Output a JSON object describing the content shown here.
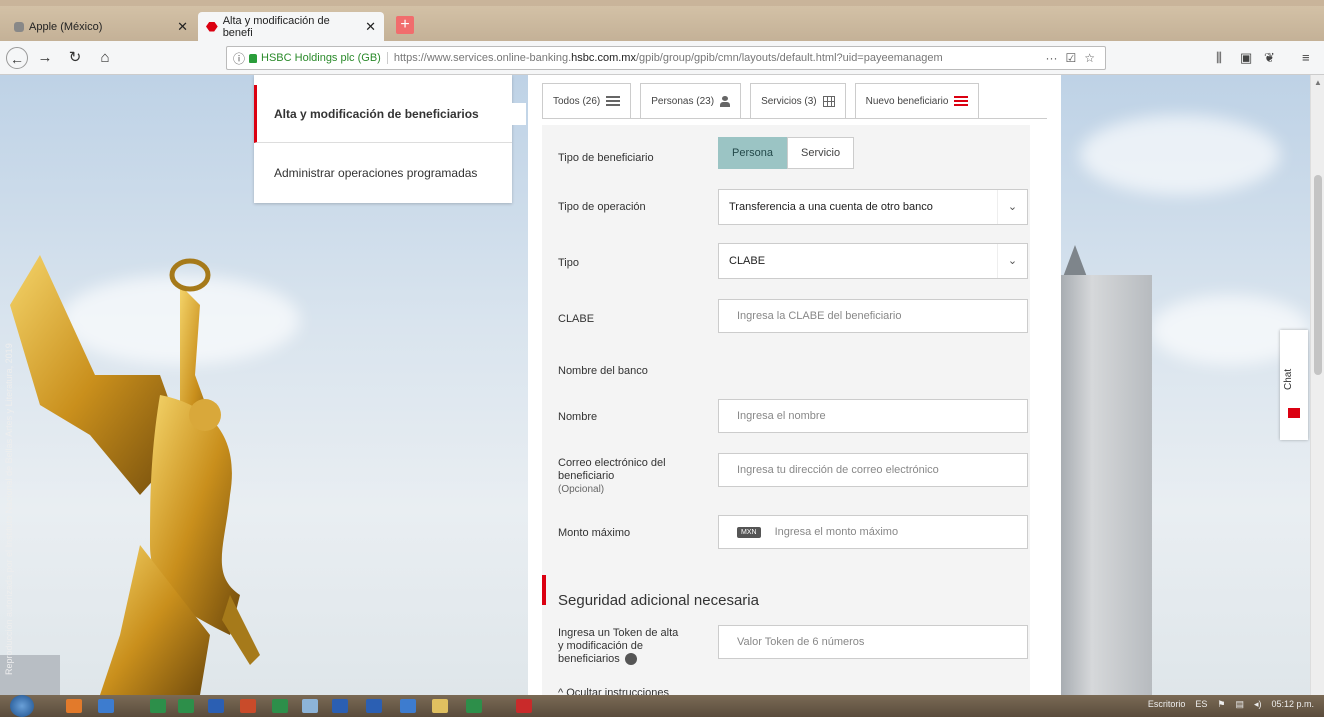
{
  "browser": {
    "tabs": [
      {
        "label": "Apple (México)",
        "active": false
      },
      {
        "label": "Alta y modificación de benefi",
        "active": true
      }
    ],
    "cert_label": "HSBC Holdings plc (GB)",
    "url_prefix": "https://www.services.online-banking.",
    "url_host": "hsbc.com.mx",
    "url_suffix": "/gpib/group/gpib/cmn/layouts/default.html?uid=payeemanagem",
    "url_more": "···"
  },
  "page": {
    "photo_credit": "Reproducción autorizada por el Instituto Nacional de Bellas Artes y Literatura, 2019"
  },
  "sidemenu": {
    "items": [
      {
        "label": "Alta y modificación de beneficiarios",
        "selected": true
      },
      {
        "label": "Administrar operaciones programadas",
        "selected": false
      }
    ]
  },
  "tabs": [
    {
      "label": "Todos (26)",
      "icon": "list-icon"
    },
    {
      "label": "Personas (23)",
      "icon": "person-icon"
    },
    {
      "label": "Servicios (3)",
      "icon": "grid-icon"
    },
    {
      "label": "Nuevo beneficiario",
      "icon": "list-red-icon"
    }
  ],
  "form": {
    "tipo_beneficiario_label": "Tipo de beneficiario",
    "toggle_persona": "Persona",
    "toggle_servicio": "Servicio",
    "tipo_operacion_label": "Tipo de operación",
    "tipo_operacion_value": "Transferencia a una cuenta de otro banco",
    "tipo_label": "Tipo",
    "tipo_value": "CLABE",
    "clabe_label": "CLABE",
    "clabe_placeholder": "Ingresa la CLABE del beneficiario",
    "banco_label": "Nombre del banco",
    "nombre_label": "Nombre",
    "nombre_placeholder": "Ingresa el nombre",
    "correo_label_1": "Correo electrónico del",
    "correo_label_2": "beneficiario",
    "correo_optional": "(Opcional)",
    "correo_placeholder": "Ingresa tu dirección de correo electrónico",
    "monto_label": "Monto máximo",
    "monto_badge": "MXN",
    "monto_placeholder": "Ingresa el monto máximo",
    "seguridad_title": "Seguridad adicional necesaria",
    "token_label_1": "Ingresa un Token de alta",
    "token_label_2": "y modificación de",
    "token_label_3": "beneficiarios",
    "token_placeholder": "Valor Token de 6 números",
    "ocultar": "Ocultar instrucciones"
  },
  "chat": {
    "label": "Chat"
  },
  "taskbar": {
    "lang": "Escritorio",
    "locale": "ES",
    "time": "05:12 p.m."
  },
  "colors": {
    "brand_red": "#db0011",
    "toggle_active": "#9bc4c4"
  }
}
